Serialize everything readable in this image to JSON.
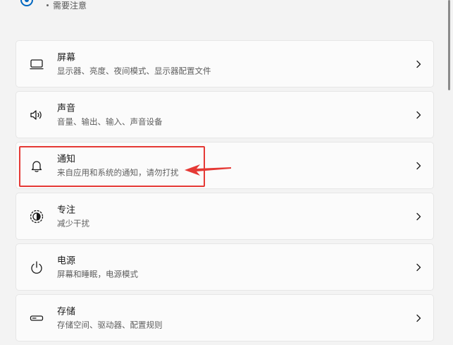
{
  "top": {
    "status_text": "需要注意"
  },
  "items": [
    {
      "id": "display",
      "title": "屏幕",
      "subtitle": "显示器、亮度、夜间模式、显示器配置文件",
      "icon": "monitor-icon"
    },
    {
      "id": "sound",
      "title": "声音",
      "subtitle": "音量、输出、输入、声音设备",
      "icon": "speaker-icon"
    },
    {
      "id": "notifications",
      "title": "通知",
      "subtitle": "来自应用和系统的通知，请勿打扰",
      "icon": "bell-icon"
    },
    {
      "id": "focus",
      "title": "专注",
      "subtitle": "减少干扰",
      "icon": "focus-icon"
    },
    {
      "id": "power",
      "title": "电源",
      "subtitle": "屏幕和睡眠，电源模式",
      "icon": "power-icon"
    },
    {
      "id": "storage",
      "title": "存储",
      "subtitle": "存储空间、驱动器、配置规则",
      "icon": "storage-icon"
    }
  ],
  "colors": {
    "card_bg": "#fbfbfb",
    "page_bg": "#f3f3f3",
    "highlight": "#e53935",
    "accent": "#0067c0"
  }
}
